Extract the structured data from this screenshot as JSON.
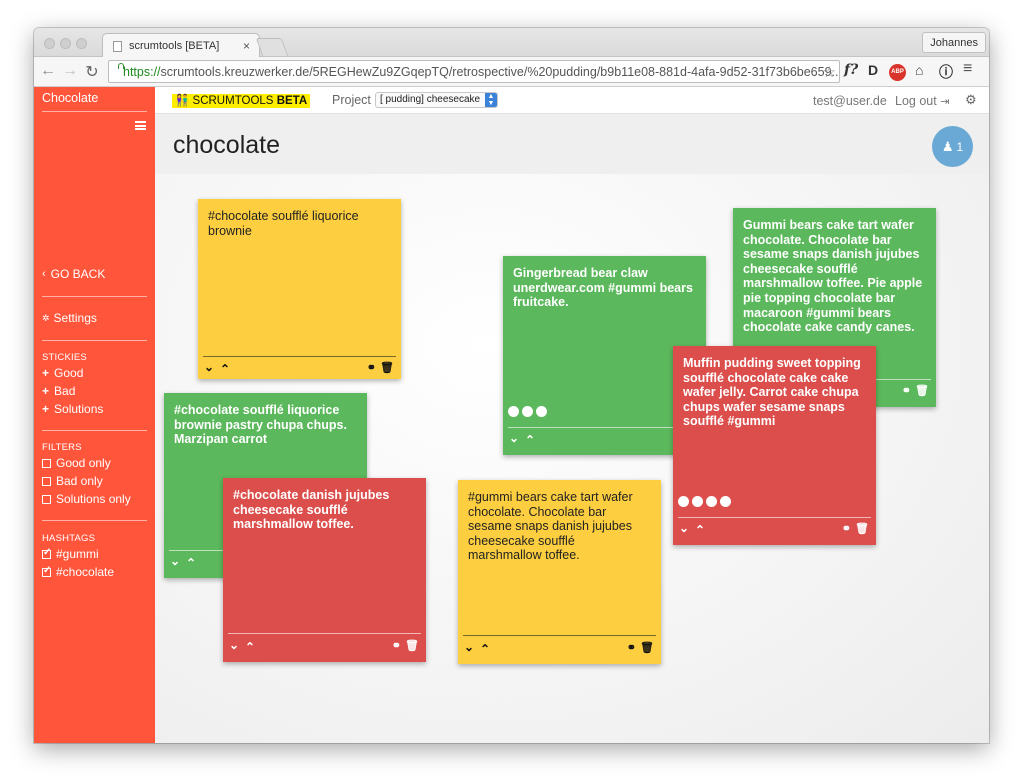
{
  "browser": {
    "tab_title": "scrumtools [BETA]",
    "tab_close": "×",
    "profile_name": "Johannes",
    "url_scheme": "https://",
    "url_rest": "scrumtools.kreuzwerker.de/5REGHewZu9ZGqepTQ/retrospective/%20pudding/b9b11e08-881d-4afa-9d52-31f73b6be659...",
    "back": "←",
    "forward": "→",
    "reload": "↻",
    "star": "☆",
    "ext1": "f?",
    "ext2": "D",
    "ext3": "ABP",
    "ext4": "⌂",
    "ext5": "ⓘ",
    "menu": "≡"
  },
  "sidebar": {
    "title": "Chocolate",
    "go_back": "GO BACK",
    "settings": "Settings",
    "stickies_header": "STICKIES",
    "stickies": [
      "Good",
      "Bad",
      "Solutions"
    ],
    "filters_header": "FILTERS",
    "filters": [
      {
        "label": "Good only",
        "checked": false
      },
      {
        "label": "Bad only",
        "checked": false
      },
      {
        "label": "Solutions only",
        "checked": false
      }
    ],
    "hashtags_header": "HASHTAGS",
    "hashtags": [
      {
        "label": "#gummi",
        "checked": true
      },
      {
        "label": "#chocolate",
        "checked": true
      }
    ]
  },
  "topbar": {
    "brand": "SCRUMTOOLS",
    "brand_beta": "BETA",
    "project_label": "Project",
    "project_value": "[ pudding] cheesecake",
    "user_email": "test@user.de",
    "logout": "Log out"
  },
  "page": {
    "title": "chocolate",
    "user_count": "1"
  },
  "stickies": [
    {
      "id": "s1",
      "color": "yellow",
      "text": "#chocolate soufflé liquorice brownie",
      "votes": 0
    },
    {
      "id": "s2",
      "color": "green",
      "text": "Gingerbread bear claw unerdwear.com #gummi bears fruitcake.",
      "votes": 3
    },
    {
      "id": "s3",
      "color": "green",
      "text": "Gummi bears cake tart wafer chocolate. Chocolate bar sesame snaps danish jujubes cheesecake soufflé marshmallow toffee. Pie apple pie topping chocolate bar macaroon #gummi bears chocolate cake candy canes.",
      "votes": 0
    },
    {
      "id": "s4",
      "color": "red",
      "text": "Muffin pudding sweet topping soufflé chocolate cake cake wafer jelly. Carrot cake chupa chups wafer sesame snaps soufflé #gummi",
      "votes": 4
    },
    {
      "id": "s5",
      "color": "green",
      "text": "#chocolate soufflé liquorice brownie pastry chupa chups. Marzipan carrot",
      "votes": 0
    },
    {
      "id": "s6",
      "color": "red",
      "text": "#chocolate danish jujubes cheesecake soufflé marshmallow toffee.",
      "votes": 0
    },
    {
      "id": "s7",
      "color": "yellow",
      "text": "#gummi bears cake tart wafer chocolate. Chocolate bar sesame snaps danish jujubes cheesecake soufflé marshmallow toffee.",
      "votes": 0
    }
  ],
  "sticky_controls": {
    "down": "⌄",
    "up": "⌃",
    "link": "🔗",
    "trash": "🗑"
  },
  "colors": {
    "sidebar": "#ff553b",
    "yellow": "#fdcf40",
    "green": "#5cb85c",
    "red": "#db4e4c",
    "brand_highlight": "#ffee00",
    "user_badge": "#6aa9d6"
  }
}
